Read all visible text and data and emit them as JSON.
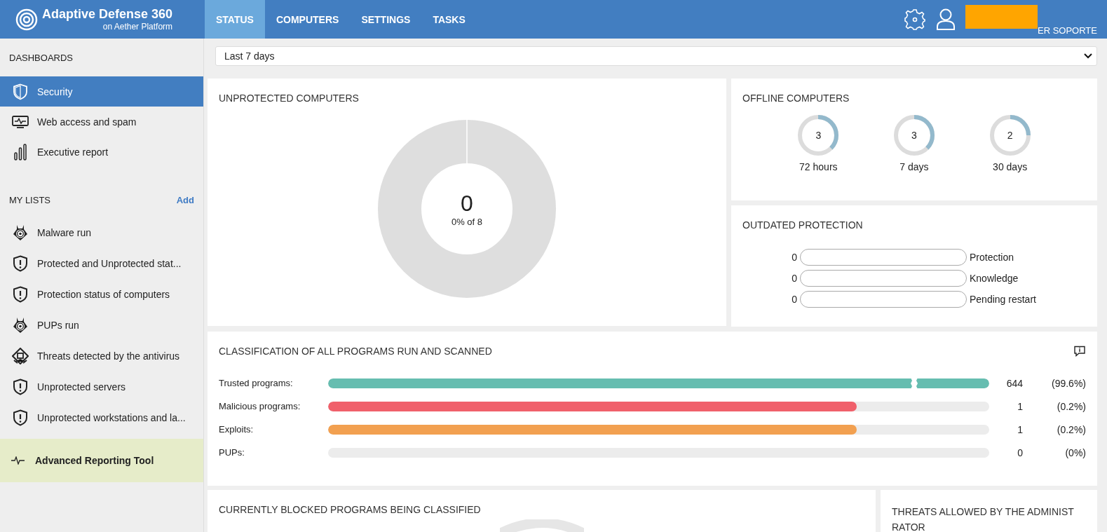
{
  "header": {
    "product": "Adaptive Defense 360",
    "subtitle": "on Aether Platform",
    "tabs": [
      {
        "label": "STATUS",
        "selected": true
      },
      {
        "label": "COMPUTERS",
        "selected": false
      },
      {
        "label": "SETTINGS",
        "selected": false
      },
      {
        "label": "TASKS",
        "selected": false
      }
    ],
    "user_name": "ER SOPORTE"
  },
  "sidebar": {
    "dashboards_heading": "DASHBOARDS",
    "dashboards": [
      {
        "label": "Security",
        "kind": "shield",
        "selected": true
      },
      {
        "label": "Web access and spam",
        "kind": "monitor",
        "selected": false
      },
      {
        "label": "Executive report",
        "kind": "bars",
        "selected": false
      }
    ],
    "lists_heading": "MY LISTS",
    "add_link": "Add",
    "lists": [
      {
        "label": "Malware run",
        "kind": "bug"
      },
      {
        "label": "Protected and Unprotected stat...",
        "kind": "shield"
      },
      {
        "label": "Protection status of computers",
        "kind": "shield"
      },
      {
        "label": "PUPs run",
        "kind": "bug"
      },
      {
        "label": "Threats detected by the antivirus",
        "kind": "threat"
      },
      {
        "label": "Unprotected servers",
        "kind": "shield"
      },
      {
        "label": "Unprotected workstations and la...",
        "kind": "shield"
      }
    ],
    "reporting_tool": "Advanced Reporting Tool"
  },
  "period_select": {
    "value": "Last 7 days"
  },
  "unprotected": {
    "title": "UNPROTECTED COMPUTERS",
    "count": "0",
    "caption": "0% of 8"
  },
  "offline": {
    "title": "OFFLINE COMPUTERS",
    "items": [
      {
        "value": "3",
        "label": "72 hours",
        "level": 0.375
      },
      {
        "value": "3",
        "label": "7 days",
        "level": 0.375
      },
      {
        "value": "2",
        "label": "30 days",
        "level": 0.25
      }
    ]
  },
  "outdated": {
    "title": "OUTDATED PROTECTION",
    "items": [
      {
        "count": "0",
        "label": "Protection",
        "level": 0
      },
      {
        "count": "0",
        "label": "Knowledge",
        "level": 0
      },
      {
        "count": "0",
        "label": "Pending restart",
        "level": 0
      }
    ]
  },
  "classification": {
    "title": "CLASSIFICATION OF ALL PROGRAMS RUN AND SCANNED",
    "rows": [
      {
        "label": "Trusted programs:",
        "count": "644",
        "percent": "(99.6%)",
        "level": 1,
        "broken": true,
        "color": "#66bdb0"
      },
      {
        "label": "Malicious programs:",
        "count": "1",
        "percent": "(0.2%)",
        "level": 0.8,
        "broken": false,
        "color": "#f0606b"
      },
      {
        "label": "Exploits:",
        "count": "1",
        "percent": "(0.2%)",
        "level": 0.8,
        "broken": false,
        "color": "#f2a050"
      },
      {
        "label": "PUPs:",
        "count": "0",
        "percent": "(0%)",
        "level": 0,
        "broken": false
      }
    ]
  },
  "blocked": {
    "title": "CURRENTLY BLOCKED PROGRAMS BEING CLASSIFIED"
  },
  "threats_allowed": {
    "title_lines": [
      "THREATS ALLOWED BY THE ADMINIST",
      "RATOR"
    ]
  }
}
